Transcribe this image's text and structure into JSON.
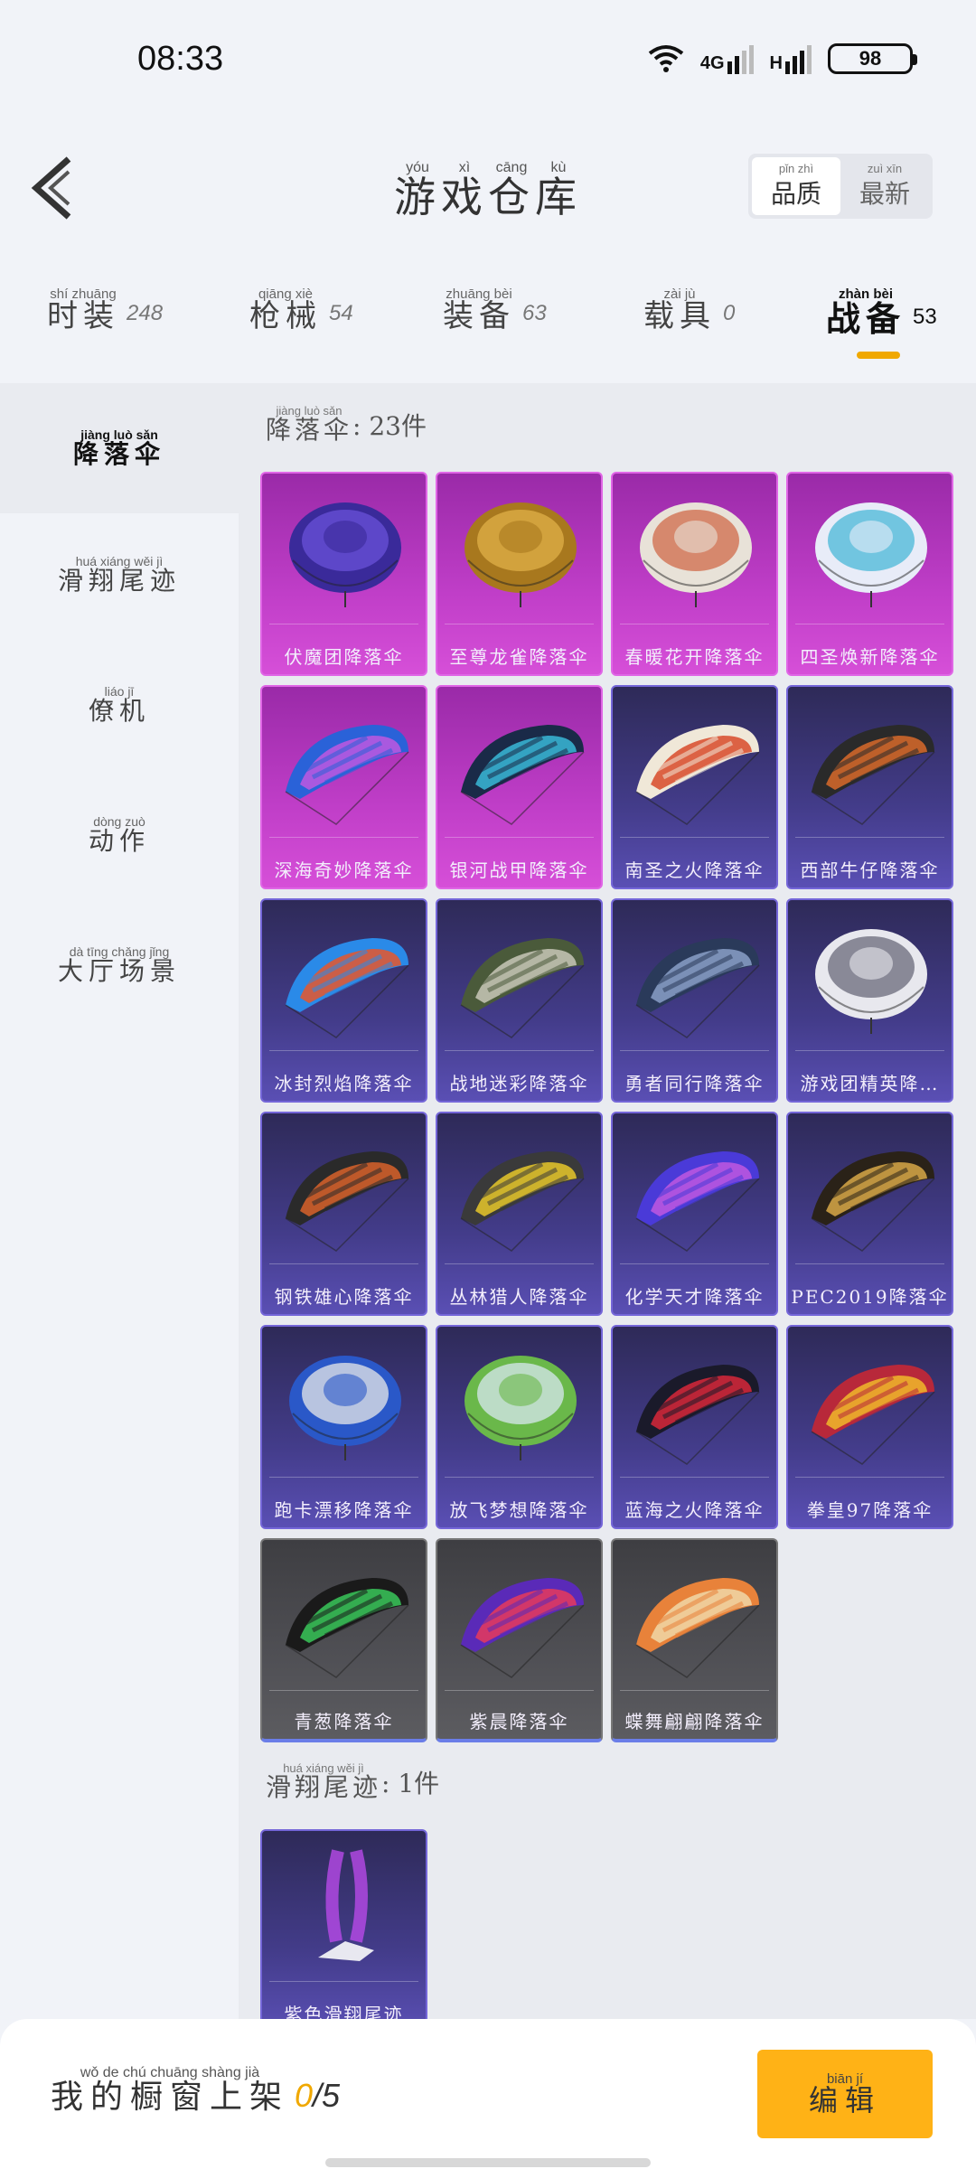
{
  "status_bar": {
    "time": "08:33",
    "net_4g": "4G",
    "net_h": "H",
    "battery": "98"
  },
  "header": {
    "title_chars": [
      "游",
      "戏",
      "仓",
      "库"
    ],
    "title_pinyin": [
      "yóu",
      "xì",
      "cāng",
      "kù"
    ],
    "sort": [
      {
        "label": "品质",
        "pinyin": "pǐn zhì",
        "active": true
      },
      {
        "label": "最新",
        "pinyin": "zuì xīn",
        "active": false
      }
    ]
  },
  "tabs": [
    {
      "label": "时装",
      "pinyin": "shí zhuāng",
      "count": "248"
    },
    {
      "label": "枪械",
      "pinyin": "qiāng xiè",
      "count": "54"
    },
    {
      "label": "装备",
      "pinyin": "zhuāng bèi",
      "count": "63"
    },
    {
      "label": "载具",
      "pinyin": "zài jù",
      "count": "0"
    },
    {
      "label": "战备",
      "pinyin": "zhàn bèi",
      "count": "53",
      "active": true
    }
  ],
  "sidebar": {
    "items": [
      {
        "label": "降落伞",
        "pinyin": "jiàng luò sǎn",
        "active": true
      },
      {
        "label": "滑翔尾迹",
        "pinyin": "huá xiáng wěi jì"
      },
      {
        "label": "僚机",
        "pinyin": "liáo jī"
      },
      {
        "label": "动作",
        "pinyin": "dòng zuò"
      },
      {
        "label": "大厅场景",
        "pinyin": "dà tīng chǎng jǐng"
      }
    ]
  },
  "sections": [
    {
      "title": "降落伞",
      "title_pinyin": "jiàng luò sǎn",
      "count_text": ": 23件",
      "items": [
        {
          "name": "伏魔团降落伞",
          "rarity": "pink",
          "colors": [
            "#3a2a9a",
            "#6a52d8"
          ]
        },
        {
          "name": "至尊龙雀降落伞",
          "rarity": "pink",
          "colors": [
            "#a8781e",
            "#e0b048"
          ]
        },
        {
          "name": "春暖花开降落伞",
          "rarity": "pink",
          "colors": [
            "#e8e2d8",
            "#d06a4a"
          ]
        },
        {
          "name": "四圣焕新降落伞",
          "rarity": "pink",
          "colors": [
            "#e8ecf8",
            "#4ab8d8"
          ]
        },
        {
          "name": "深海奇妙降落伞",
          "rarity": "pink",
          "colors": [
            "#2a62d8",
            "#c058e0"
          ]
        },
        {
          "name": "银河战甲降落伞",
          "rarity": "pink",
          "colors": [
            "#1a2a48",
            "#3ab8d8"
          ]
        },
        {
          "name": "南圣之火降落伞",
          "rarity": "purple",
          "colors": [
            "#f0e8d8",
            "#d84a2a"
          ]
        },
        {
          "name": "西部牛仔降落伞",
          "rarity": "purple",
          "colors": [
            "#2a2a2a",
            "#d86a2a"
          ]
        },
        {
          "name": "冰封烈焰降落伞",
          "rarity": "purple",
          "colors": [
            "#2a8ae8",
            "#e8562a"
          ]
        },
        {
          "name": "战地迷彩降落伞",
          "rarity": "purple",
          "colors": [
            "#4a5a3a",
            "#c8c8b8"
          ]
        },
        {
          "name": "勇者同行降落伞",
          "rarity": "purple",
          "colors": [
            "#2a3a5a",
            "#8aa0c8"
          ]
        },
        {
          "name": "游戏团精英降…",
          "rarity": "purple",
          "colors": [
            "#e8e8ee",
            "#6a6a7a"
          ]
        },
        {
          "name": "钢铁雄心降落伞",
          "rarity": "purple",
          "colors": [
            "#2a2a2a",
            "#d8622a"
          ]
        },
        {
          "name": "丛林猎人降落伞",
          "rarity": "purple",
          "colors": [
            "#3a3a3a",
            "#e8c82a"
          ]
        },
        {
          "name": "化学天才降落伞",
          "rarity": "purple",
          "colors": [
            "#4a3ad8",
            "#c058e0"
          ]
        },
        {
          "name": "PEC2019降落伞",
          "rarity": "purple",
          "colors": [
            "#2a2218",
            "#d8a848"
          ]
        },
        {
          "name": "跑卡漂移降落伞",
          "rarity": "purple",
          "colors": [
            "#2a58c8",
            "#e8e8e8"
          ]
        },
        {
          "name": "放飞梦想降落伞",
          "rarity": "purple",
          "colors": [
            "#6ab84a",
            "#d8e8f0"
          ]
        },
        {
          "name": "蓝海之火降落伞",
          "rarity": "purple",
          "colors": [
            "#1a1a2a",
            "#d8283a"
          ]
        },
        {
          "name": "拳皇97降落伞",
          "rarity": "purple",
          "colors": [
            "#b8283a",
            "#f0b82a"
          ]
        },
        {
          "name": "青葱降落伞",
          "rarity": "gray",
          "colors": [
            "#1a1a1a",
            "#3ac85a"
          ]
        },
        {
          "name": "紫晨降落伞",
          "rarity": "gray",
          "colors": [
            "#5a2ab8",
            "#e83a5a"
          ]
        },
        {
          "name": "蝶舞翩翩降落伞",
          "rarity": "gray",
          "colors": [
            "#e8823a",
            "#f0d8a8"
          ]
        }
      ]
    },
    {
      "title": "滑翔尾迹",
      "title_pinyin": "huá xiáng wěi jì",
      "count_text": ": 1件",
      "items": [
        {
          "name": "紫色滑翔尾迹",
          "rarity": "purple",
          "colors": [
            "#b84ae8",
            "#e8e8f0"
          ]
        }
      ]
    }
  ],
  "bottom_bar": {
    "shelf_label": "我的橱窗上架",
    "shelf_pinyin": "wǒ de chú chuāng shàng jià",
    "shelf_used": "0",
    "shelf_total": "/5",
    "edit_label": "编辑",
    "edit_pinyin": "biān jí"
  }
}
